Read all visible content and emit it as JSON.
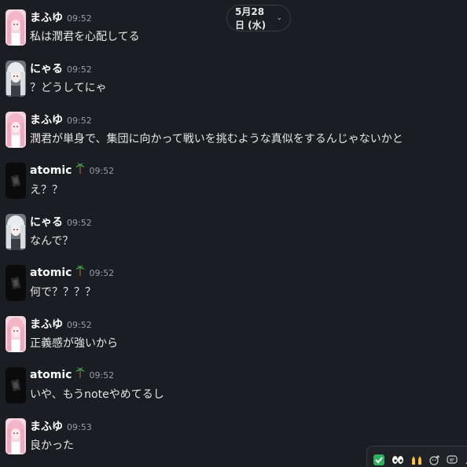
{
  "date_divider": {
    "label": "5月28日 (水)",
    "chevron": "chevron-down-icon"
  },
  "messages": [
    {
      "author": "まふゆ",
      "time": "09:52",
      "text": "私は潤君を心配してる",
      "avatar": "pink-anime-avatar"
    },
    {
      "author": "にゃる",
      "time": "09:52",
      "text": "？どうしてにゃ",
      "avatar": "white-hair-anime-avatar"
    },
    {
      "author": "まふゆ",
      "time": "09:52",
      "text": "潤君が単身で、集団に向かって戦いを挑むような真似をするんじゃないかと",
      "avatar": "pink-anime-avatar"
    },
    {
      "author": "atomic",
      "time": "09:52",
      "text": "え？？",
      "avatar": "dark-avatar",
      "status_emoji": "palm-tree-icon"
    },
    {
      "author": "にゃる",
      "time": "09:52",
      "text": "なんで？",
      "avatar": "white-hair-anime-avatar"
    },
    {
      "author": "atomic",
      "time": "09:52",
      "text": "何で？？？？",
      "avatar": "dark-avatar",
      "status_emoji": "palm-tree-icon"
    },
    {
      "author": "まふゆ",
      "time": "09:52",
      "text": "正義感が強いから",
      "avatar": "pink-anime-avatar"
    },
    {
      "author": "atomic",
      "time": "09:52",
      "text": "いや、もうnoteやめてるし",
      "avatar": "dark-avatar",
      "status_emoji": "palm-tree-icon"
    },
    {
      "author": "まふゆ",
      "time": "09:53",
      "text": "良かった",
      "avatar": "pink-anime-avatar"
    }
  ],
  "toolbar": {
    "buttons": [
      "check-mark-reaction-icon",
      "eyes-reaction-icon",
      "raised-hands-reaction-icon",
      "add-reaction-icon",
      "reply-in-thread-icon",
      "more-actions-icon"
    ]
  },
  "colors": {
    "background": "#1a1d21",
    "text": "#e6e6e6",
    "name": "#ffffff",
    "timestamp": "#9a9ca0",
    "border": "#3a3d42"
  }
}
